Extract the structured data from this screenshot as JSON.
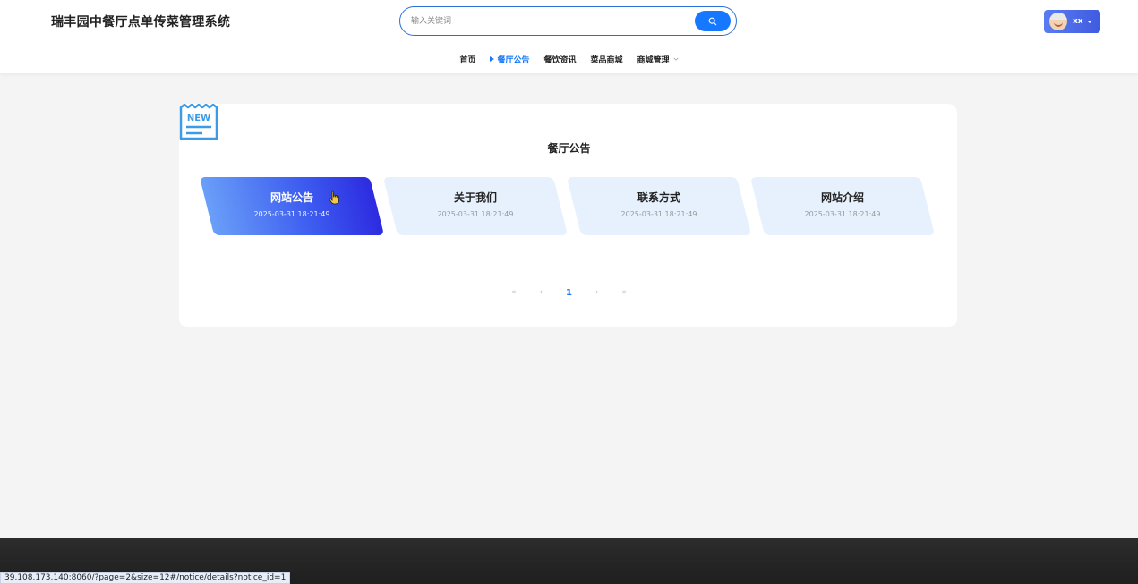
{
  "header": {
    "site_title": "瑞丰园中餐厅点单传菜管理系统",
    "search_placeholder": "输入关键词",
    "user_name": "xx"
  },
  "nav": {
    "items": [
      {
        "label": "首页",
        "active": false
      },
      {
        "label": "餐厅公告",
        "active": true
      },
      {
        "label": "餐饮资讯",
        "active": false
      },
      {
        "label": "菜品商城",
        "active": false
      },
      {
        "label": "商城管理",
        "active": false,
        "has_dropdown": true
      }
    ]
  },
  "main": {
    "badge_text": "NEW",
    "title": "餐厅公告",
    "notices": [
      {
        "title": "网站公告",
        "date": "2025-03-31 18:21:49",
        "active": true
      },
      {
        "title": "关于我们",
        "date": "2025-03-31 18:21:49",
        "active": false
      },
      {
        "title": "联系方式",
        "date": "2025-03-31 18:21:49",
        "active": false
      },
      {
        "title": "网站介绍",
        "date": "2025-03-31 18:21:49",
        "active": false
      }
    ],
    "pagination": {
      "first": "«",
      "prev": "‹",
      "current": "1",
      "next": "›",
      "last": "»"
    }
  },
  "status_bar": {
    "url": "39.108.173.140:8060/?page=2&size=12#/notice/details?notice_id=1"
  }
}
